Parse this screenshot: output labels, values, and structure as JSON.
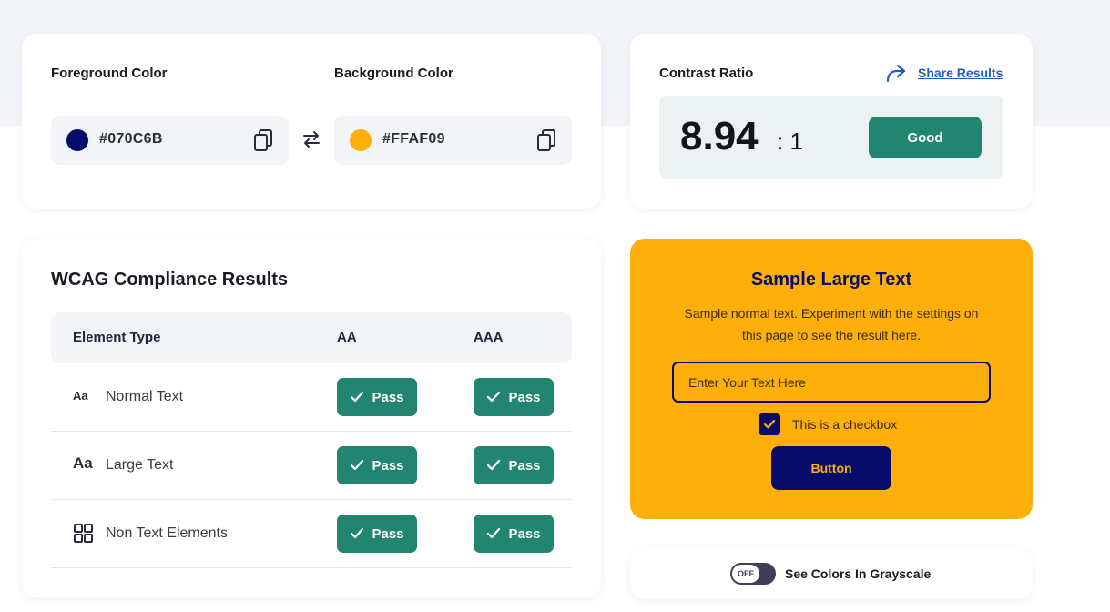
{
  "colors_panel": {
    "foreground": {
      "label": "Foreground Color",
      "hex": "#070C6B",
      "swatch": "#070c6b",
      "icon": "copy-icon"
    },
    "background": {
      "label": "Background Color",
      "hex": "#FFAF09",
      "swatch": "#ffaf09",
      "icon": "copy-icon"
    },
    "swap_icon": "swap-arrows-icon"
  },
  "contrast": {
    "title": "Contrast Ratio",
    "share_label": "Share Results",
    "ratio": "8.94",
    "suffix": ": 1",
    "grade": "Good",
    "grade_color": "#228571"
  },
  "wcag": {
    "title": "WCAG Compliance Results",
    "columns": [
      "Element Type",
      "AA",
      "AAA"
    ],
    "rows": [
      {
        "icon_text": "Aa",
        "label": "Normal Text",
        "aa": "Pass",
        "aaa": "Pass"
      },
      {
        "icon_text": "Aa",
        "label": "Large Text",
        "aa": "Pass",
        "aaa": "Pass"
      },
      {
        "icon": "grid-icon",
        "label": "Non Text Elements",
        "aa": "Pass",
        "aaa": "Pass"
      }
    ]
  },
  "sample": {
    "title": "Sample Large Text",
    "body": "Sample normal text. Experiment with the settings on this page to see the result here.",
    "input_placeholder": "Enter Your Text Here",
    "checkbox_label": "This is a checkbox",
    "checkbox_checked": true,
    "button_label": "Button"
  },
  "grayscale": {
    "toggle_state": "OFF",
    "label": "See Colors In Grayscale"
  }
}
